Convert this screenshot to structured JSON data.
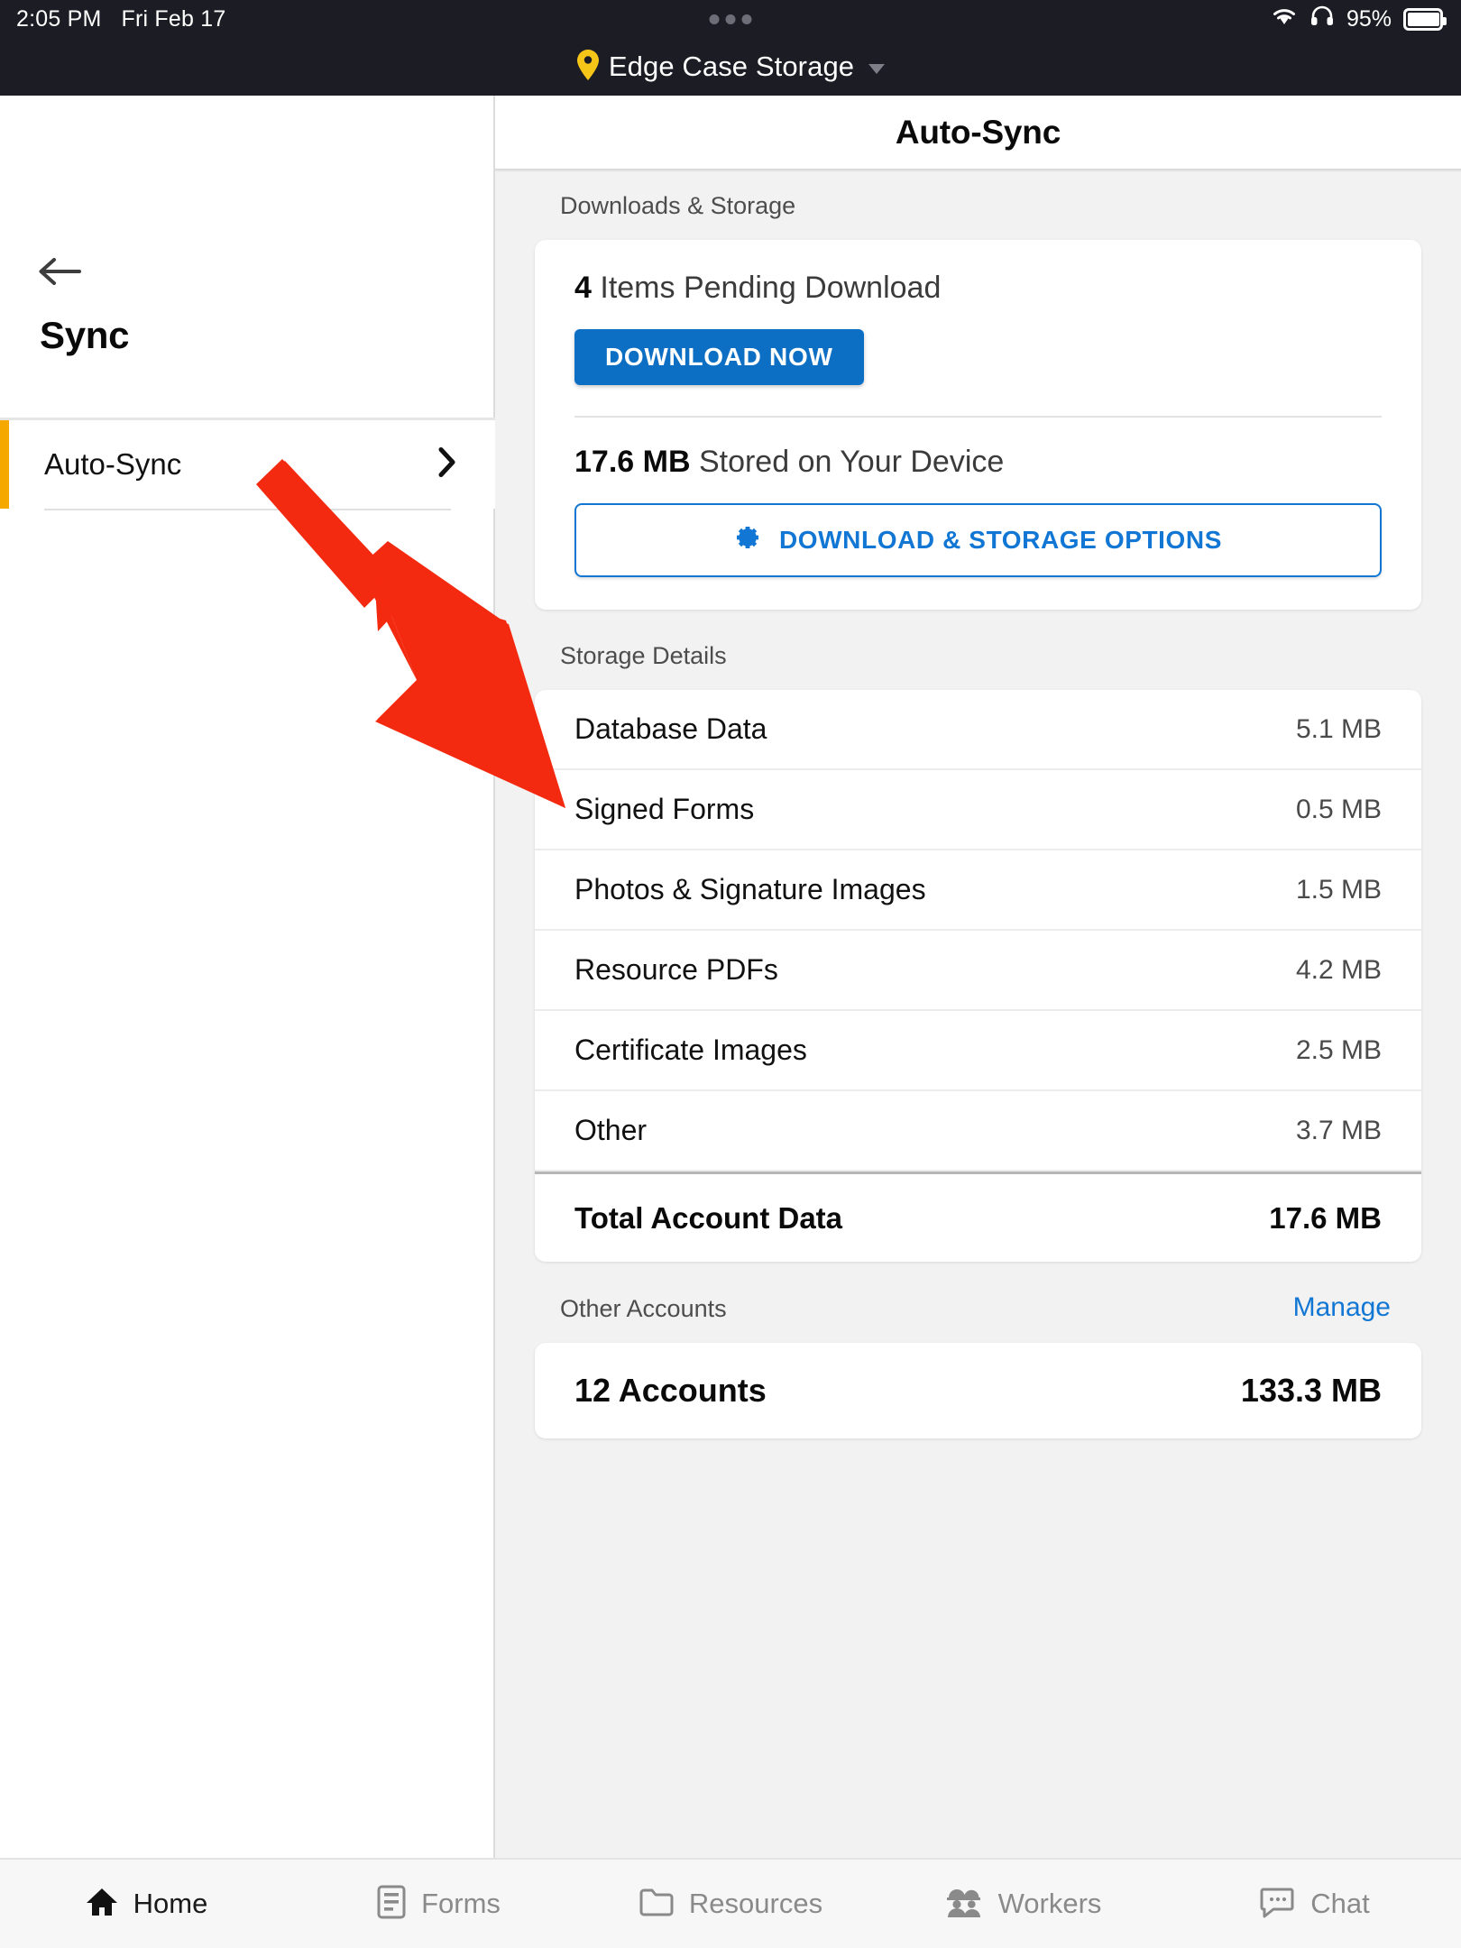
{
  "statusbar": {
    "time": "2:05 PM",
    "date": "Fri Feb 17",
    "battery_percent": "95%",
    "wifi_icon": "wifi-icon",
    "headphones_icon": "headphones-icon",
    "battery_icon": "battery-icon",
    "handle_icon": "multitask-handle-icon"
  },
  "appbar": {
    "pin_icon": "location-pin-icon",
    "title": "Edge Case Storage",
    "caret_icon": "chevron-down-icon"
  },
  "sidebar": {
    "back_icon": "back-arrow-icon",
    "title": "Sync",
    "items": [
      {
        "label": "Auto-Sync",
        "chevron_icon": "chevron-right-icon",
        "selected": true
      }
    ],
    "accent_color": "#f5a800"
  },
  "main": {
    "header_title": "Auto-Sync",
    "downloads_section": {
      "label": "Downloads & Storage",
      "pending_count": "4",
      "pending_text": "Items Pending Download",
      "download_button": "DOWNLOAD NOW",
      "stored_size": "17.6 MB",
      "stored_text": "Stored on Your Device",
      "options_button": "DOWNLOAD & STORAGE OPTIONS",
      "gear_icon": "gear-icon"
    },
    "storage_details": {
      "label": "Storage Details",
      "rows": [
        {
          "name": "Database Data",
          "size": "5.1 MB"
        },
        {
          "name": "Signed Forms",
          "size": "0.5 MB"
        },
        {
          "name": "Photos & Signature Images",
          "size": "1.5 MB"
        },
        {
          "name": "Resource PDFs",
          "size": "4.2 MB"
        },
        {
          "name": "Certificate Images",
          "size": "2.5 MB"
        },
        {
          "name": "Other",
          "size": "3.7 MB"
        }
      ],
      "total_name": "Total Account Data",
      "total_size": "17.6 MB"
    },
    "other_accounts": {
      "label": "Other Accounts",
      "manage_link": "Manage",
      "count_label": "12 Accounts",
      "size": "133.3 MB"
    }
  },
  "annotation": {
    "arrow_color": "#f42a10",
    "target": "Database Data row"
  },
  "bottomnav": {
    "items": [
      {
        "label": "Home",
        "icon": "home-icon",
        "active": true
      },
      {
        "label": "Forms",
        "icon": "forms-icon",
        "active": false
      },
      {
        "label": "Resources",
        "icon": "folder-icon",
        "active": false
      },
      {
        "label": "Workers",
        "icon": "workers-icon",
        "active": false
      },
      {
        "label": "Chat",
        "icon": "chat-icon",
        "active": false
      }
    ]
  },
  "colors": {
    "accent_blue": "#0d6fc4",
    "link_blue": "#1277d4",
    "sidebar_accent": "#f5a800",
    "statusbar_bg": "#1c1c24",
    "page_bg": "#f2f2f2"
  }
}
